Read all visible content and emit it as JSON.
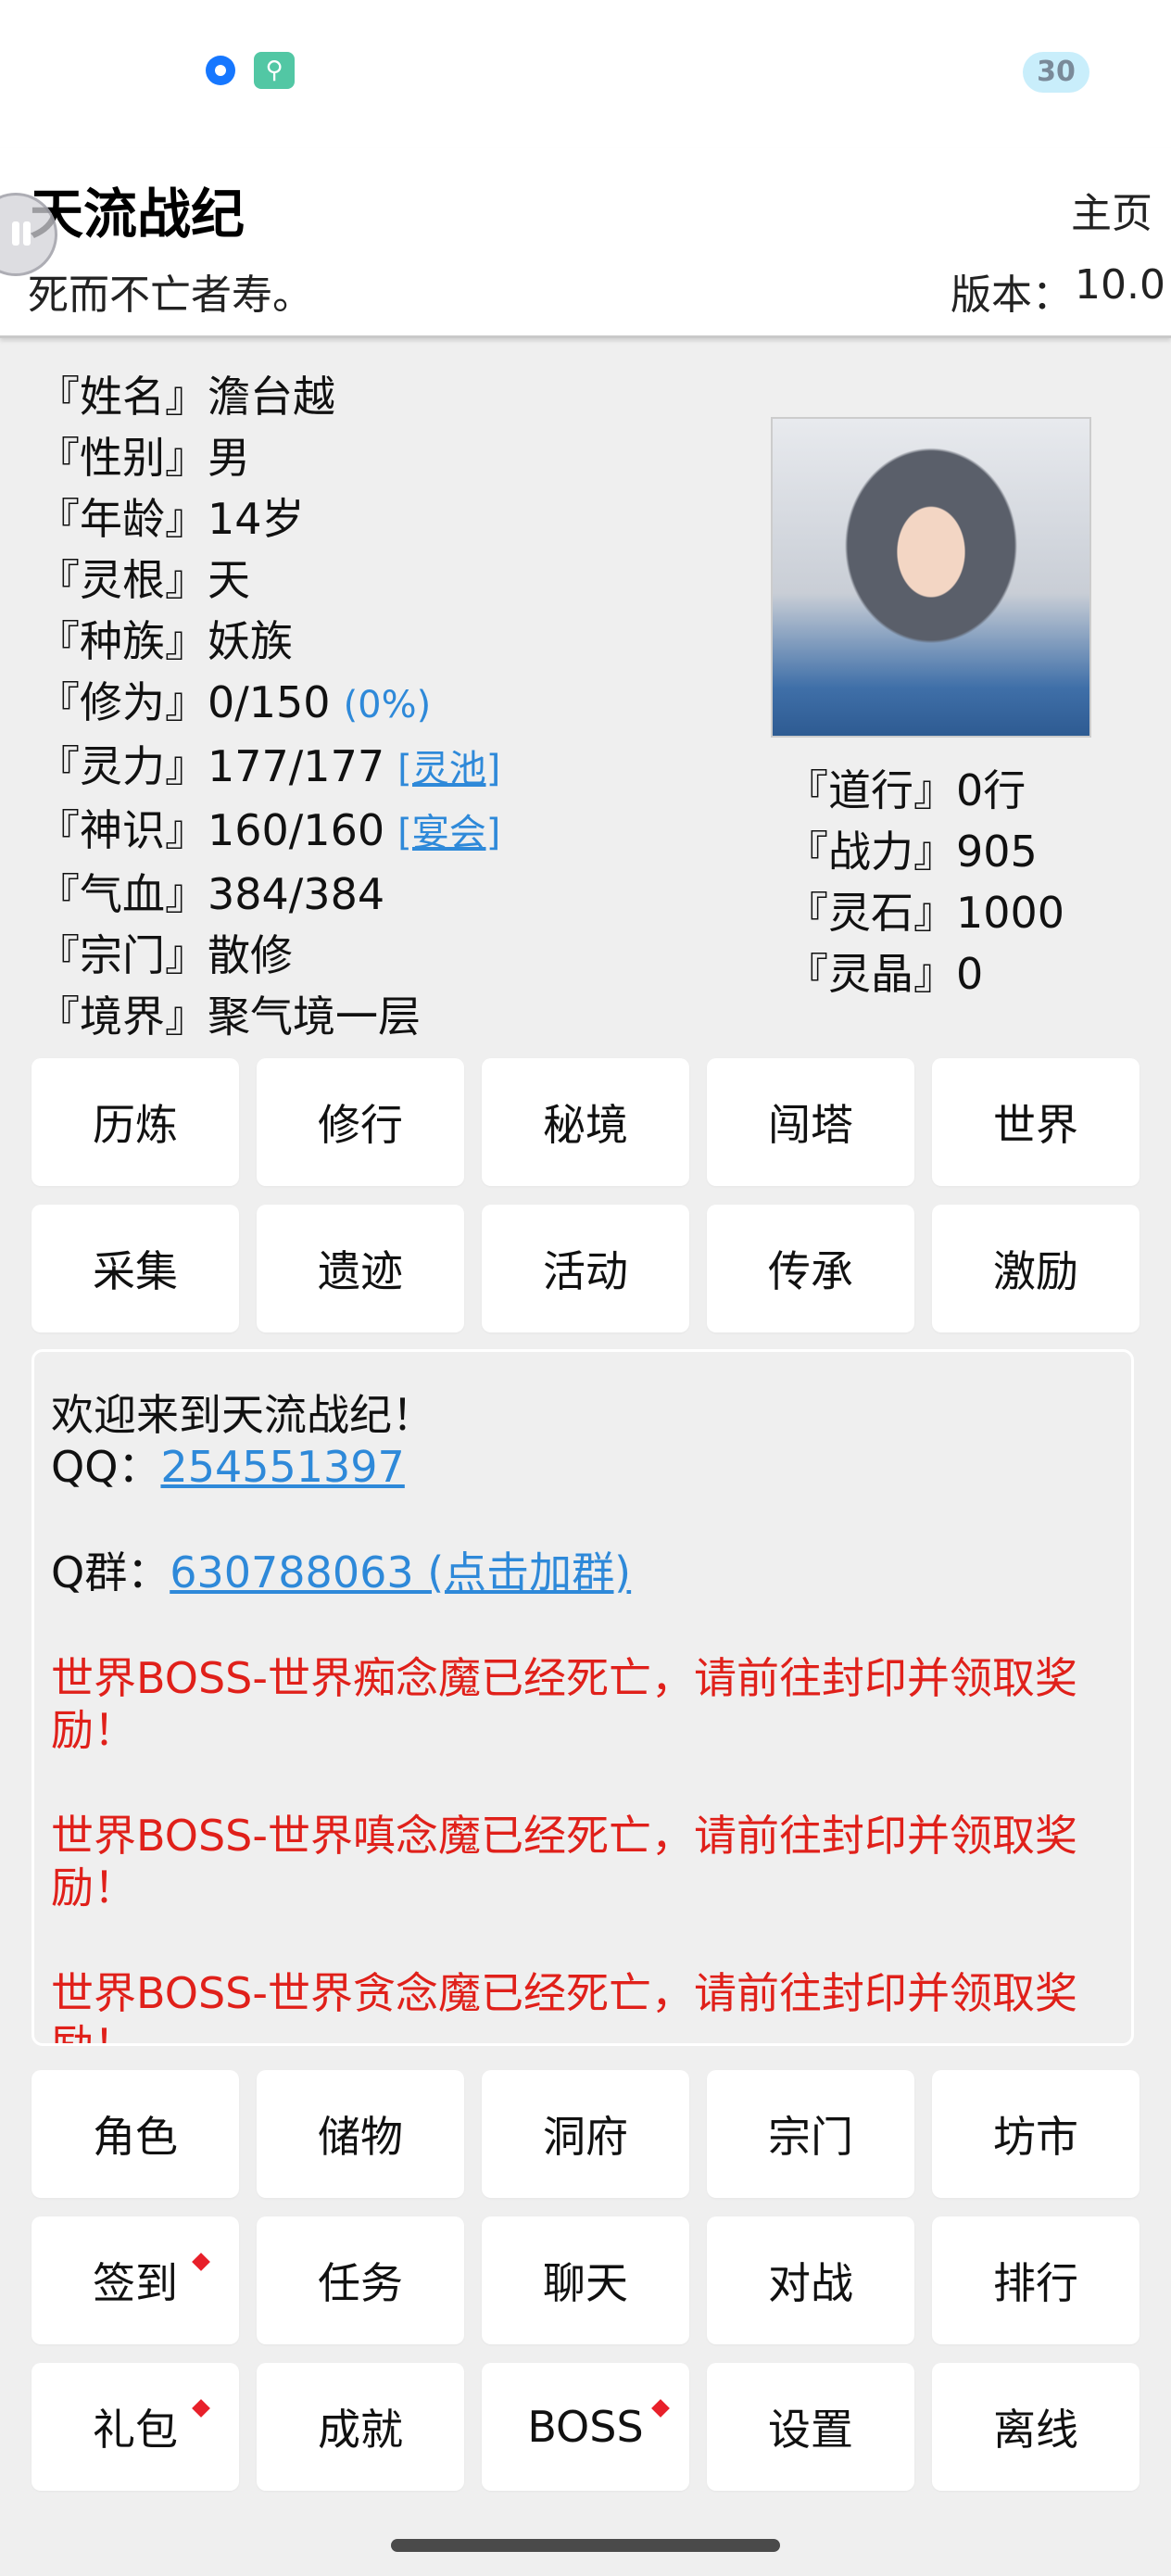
{
  "status_bar": {
    "battery": "30"
  },
  "header": {
    "title": "天流战纪",
    "home": "主页",
    "subtitle": "死而不亡者寿。",
    "version_label": "版本：",
    "version_value": "10.0"
  },
  "character": {
    "stats": [
      {
        "key": "『姓名』",
        "value": "澹台越"
      },
      {
        "key": "『性别』",
        "value": "男"
      },
      {
        "key": "『年龄』",
        "value": "14岁"
      },
      {
        "key": "『灵根』",
        "value": "天"
      },
      {
        "key": "『种族』",
        "value": "妖族"
      },
      {
        "key": "『修为』",
        "value": "0/150",
        "extra": "(0%)"
      },
      {
        "key": "『灵力』",
        "value": "177/177",
        "link": "[灵池]"
      },
      {
        "key": "『神识』",
        "value": "160/160",
        "link": "[宴会]"
      },
      {
        "key": "『气血』",
        "value": "384/384"
      },
      {
        "key": "『宗门』",
        "value": "散修"
      },
      {
        "key": "『境界』",
        "value": "聚气境一层"
      }
    ],
    "stats_right": [
      {
        "key": "『道行』",
        "value": "0行"
      },
      {
        "key": "『战力』",
        "value": "905"
      },
      {
        "key": "『灵石』",
        "value": "1000"
      },
      {
        "key": "『灵晶』",
        "value": "0"
      }
    ]
  },
  "top_menu": [
    {
      "label": "历炼"
    },
    {
      "label": "修行"
    },
    {
      "label": "秘境"
    },
    {
      "label": "闯塔"
    },
    {
      "label": "世界"
    },
    {
      "label": "采集"
    },
    {
      "label": "遗迹"
    },
    {
      "label": "活动"
    },
    {
      "label": "传承"
    },
    {
      "label": "激励"
    }
  ],
  "messages": {
    "welcome": "欢迎来到天流战纪！",
    "qq_label": "QQ：",
    "qq_number": "254551397",
    "group_label": "Q群：",
    "group_number": "630788063 (点击加群)",
    "boss_notices": [
      "世界BOSS-世界痴念魔已经死亡，请前往封印并领取奖励！",
      "世界BOSS-世界嗔念魔已经死亡，请前往封印并领取奖励！",
      "世界BOSS-世界贪念魔已经死亡，请前往封印并领取奖励！"
    ]
  },
  "bottom_menu": [
    {
      "label": "角色"
    },
    {
      "label": "储物"
    },
    {
      "label": "洞府"
    },
    {
      "label": "宗门"
    },
    {
      "label": "坊市"
    },
    {
      "label": "签到",
      "badge": true
    },
    {
      "label": "任务"
    },
    {
      "label": "聊天"
    },
    {
      "label": "对战"
    },
    {
      "label": "排行"
    },
    {
      "label": "礼包",
      "badge": true
    },
    {
      "label": "成就"
    },
    {
      "label": "BOSS",
      "badge": true
    },
    {
      "label": "设置"
    },
    {
      "label": "离线"
    }
  ],
  "colors": {
    "link": "#2e89d9",
    "notice": "#e0201a",
    "badge": "#e8202a"
  }
}
